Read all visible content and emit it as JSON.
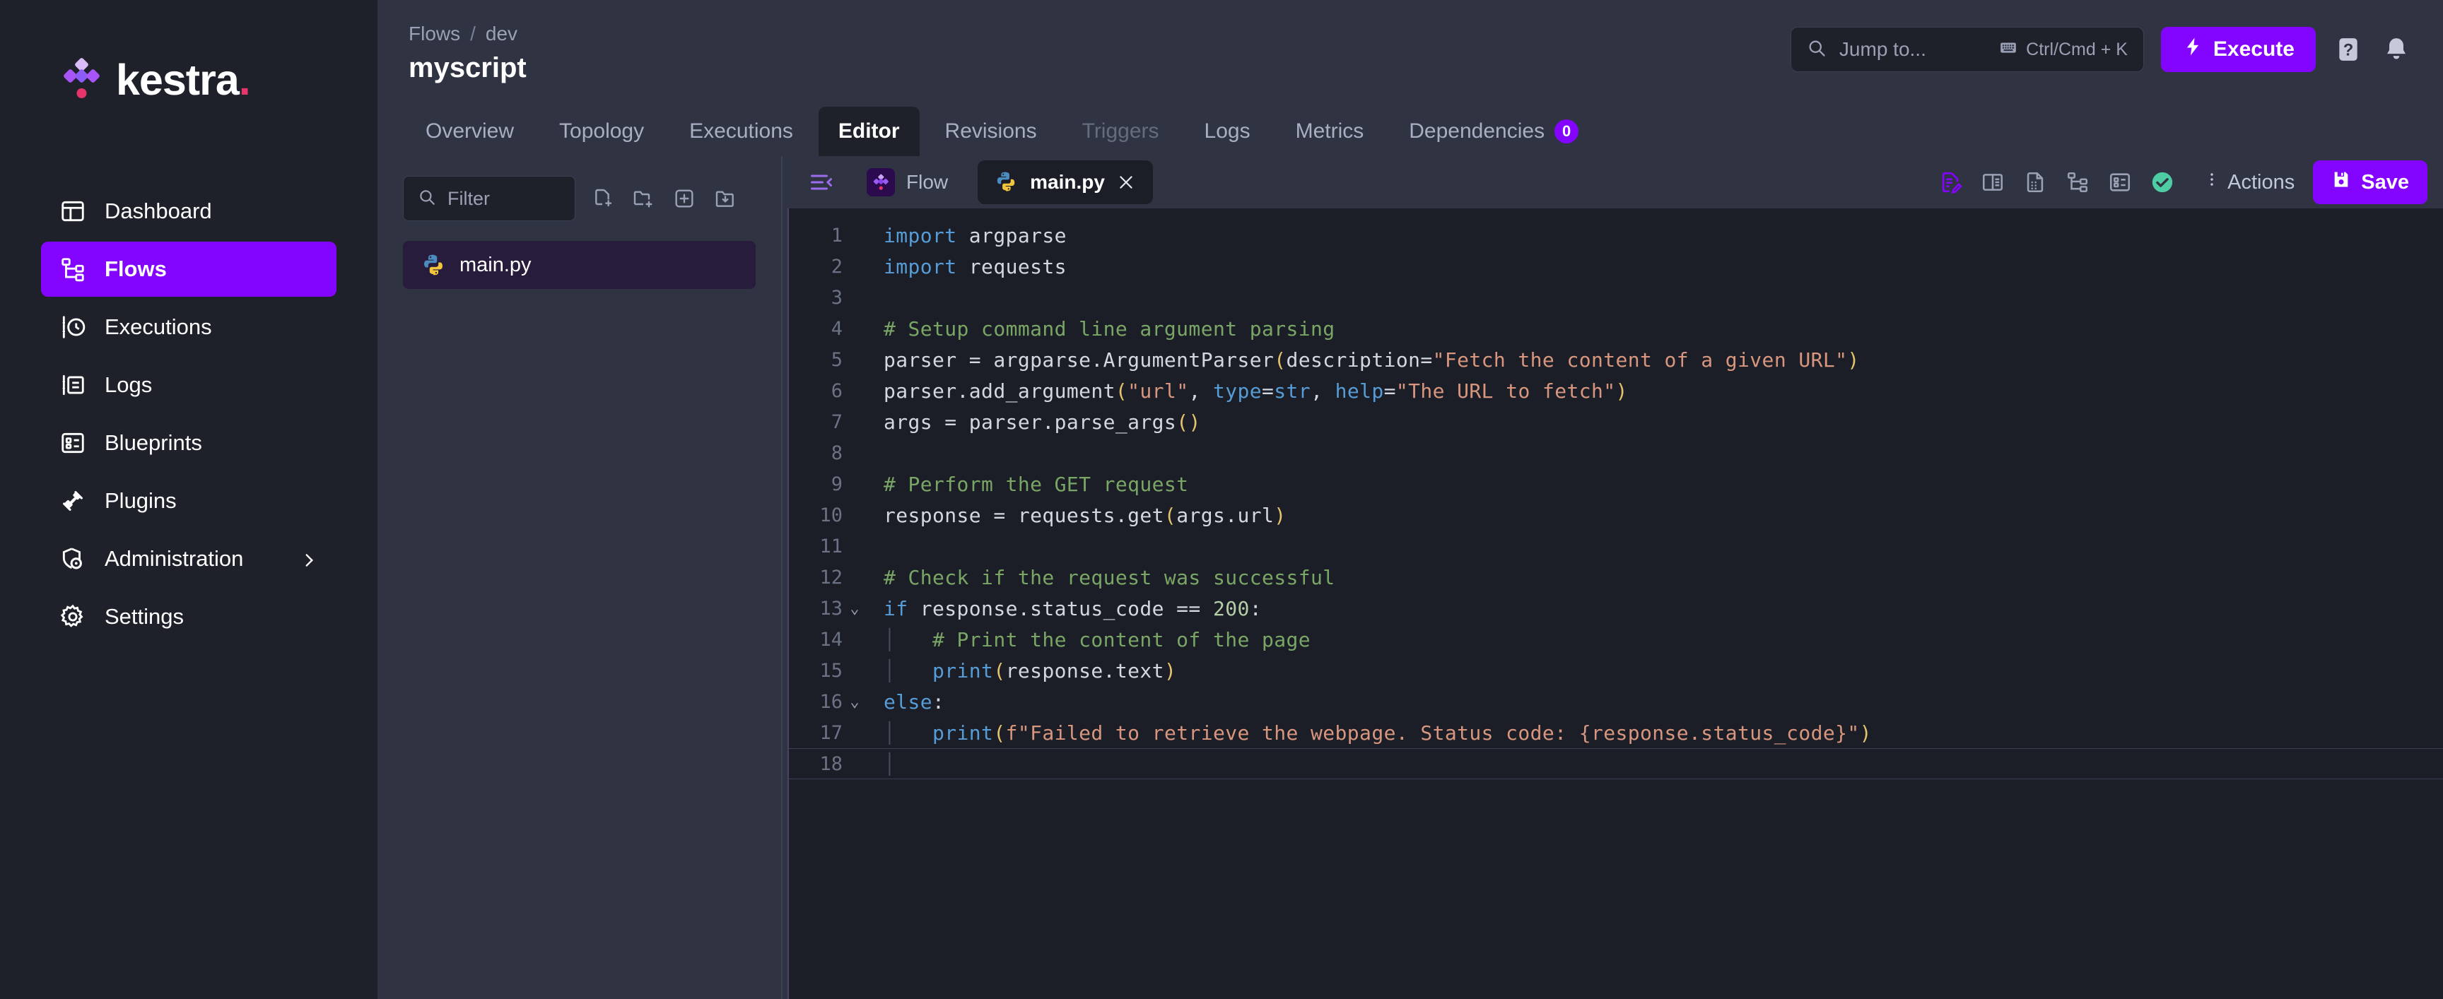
{
  "brand": {
    "name": "kestra",
    "dot": ".",
    "accent": "#8405ff",
    "pink": "#e5356a"
  },
  "sidebar": {
    "items": [
      {
        "label": "Dashboard",
        "icon": "dashboard-icon",
        "active": false,
        "chevron": false
      },
      {
        "label": "Flows",
        "icon": "flows-icon",
        "active": true,
        "chevron": false
      },
      {
        "label": "Executions",
        "icon": "executions-icon",
        "active": false,
        "chevron": false
      },
      {
        "label": "Logs",
        "icon": "logs-icon",
        "active": false,
        "chevron": false
      },
      {
        "label": "Blueprints",
        "icon": "blueprints-icon",
        "active": false,
        "chevron": false
      },
      {
        "label": "Plugins",
        "icon": "plugins-icon",
        "active": false,
        "chevron": false
      },
      {
        "label": "Administration",
        "icon": "administration-icon",
        "active": false,
        "chevron": true
      },
      {
        "label": "Settings",
        "icon": "settings-icon",
        "active": false,
        "chevron": false
      }
    ]
  },
  "header": {
    "breadcrumb": [
      "Flows",
      "dev"
    ],
    "separator": "/",
    "title": "myscript",
    "search": {
      "placeholder": "Jump to...",
      "shortcut": "Ctrl/Cmd + K",
      "icon": "search-icon",
      "kbd_icon": "keyboard-icon"
    },
    "execute_label": "Execute",
    "help_icon": "help-icon",
    "bell_icon": "bell-icon"
  },
  "tabs": [
    {
      "label": "Overview",
      "active": false,
      "disabled": false
    },
    {
      "label": "Topology",
      "active": false,
      "disabled": false
    },
    {
      "label": "Executions",
      "active": false,
      "disabled": false
    },
    {
      "label": "Editor",
      "active": true,
      "disabled": false
    },
    {
      "label": "Revisions",
      "active": false,
      "disabled": false
    },
    {
      "label": "Triggers",
      "active": false,
      "disabled": true
    },
    {
      "label": "Logs",
      "active": false,
      "disabled": false
    },
    {
      "label": "Metrics",
      "active": false,
      "disabled": false
    },
    {
      "label": "Dependencies",
      "active": false,
      "disabled": false,
      "badge": "0"
    }
  ],
  "filepanel": {
    "filter_placeholder": "Filter",
    "search_icon": "search-icon",
    "toolbar": [
      {
        "icon": "new-file-icon",
        "name": "create-file-button"
      },
      {
        "icon": "new-folder-icon",
        "name": "create-folder-button"
      },
      {
        "icon": "add-icon",
        "name": "add-button"
      },
      {
        "icon": "import-folder-icon",
        "name": "import-folder-button"
      }
    ],
    "files": [
      {
        "name": "main.py",
        "icon": "python-icon",
        "selected": true
      }
    ]
  },
  "editor_tabs": {
    "collapse_icon": "collapse-panel-icon",
    "items": [
      {
        "label": "Flow",
        "icon": "kestra-icon",
        "active": false,
        "closable": false
      },
      {
        "label": "main.py",
        "icon": "python-icon",
        "active": true,
        "closable": true,
        "close_icon": "close-icon"
      }
    ]
  },
  "editor_toolbar": {
    "icons": [
      {
        "icon": "edit-file-icon",
        "active": true
      },
      {
        "icon": "split-view-icon",
        "active": false
      },
      {
        "icon": "file-document-icon",
        "active": false
      },
      {
        "icon": "topology-tree-icon",
        "active": false
      },
      {
        "icon": "blueprint-list-icon",
        "active": false
      },
      {
        "icon": "validation-success-icon",
        "active": false,
        "color": "#4ecca3"
      }
    ],
    "actions_label": "Actions",
    "actions_icon": "kebab-menu-icon",
    "save_label": "Save",
    "save_icon": "save-disk-icon"
  },
  "code": {
    "language": "python",
    "filename": "main.py",
    "cursor_line": 18,
    "lines": [
      {
        "n": 1,
        "fold": "",
        "tokens": [
          {
            "t": "kw",
            "v": "import"
          },
          {
            "t": "pl",
            "v": " argparse"
          }
        ]
      },
      {
        "n": 2,
        "fold": "",
        "tokens": [
          {
            "t": "kw",
            "v": "import"
          },
          {
            "t": "pl",
            "v": " requests"
          }
        ]
      },
      {
        "n": 3,
        "fold": "",
        "tokens": []
      },
      {
        "n": 4,
        "fold": "",
        "tokens": [
          {
            "t": "cmt",
            "v": "# Setup command line argument parsing"
          }
        ]
      },
      {
        "n": 5,
        "fold": "",
        "tokens": [
          {
            "t": "pl",
            "v": "parser = argparse.ArgumentParser"
          },
          {
            "t": "par",
            "v": "("
          },
          {
            "t": "pl",
            "v": "description="
          },
          {
            "t": "str",
            "v": "\"Fetch the content of a given URL\""
          },
          {
            "t": "par",
            "v": ")"
          }
        ]
      },
      {
        "n": 6,
        "fold": "",
        "tokens": [
          {
            "t": "pl",
            "v": "parser.add_argument"
          },
          {
            "t": "par",
            "v": "("
          },
          {
            "t": "str",
            "v": "\"url\""
          },
          {
            "t": "pl",
            "v": ", "
          },
          {
            "t": "kw",
            "v": "type"
          },
          {
            "t": "pl",
            "v": "="
          },
          {
            "t": "kw",
            "v": "str"
          },
          {
            "t": "pl",
            "v": ", "
          },
          {
            "t": "kw",
            "v": "help"
          },
          {
            "t": "pl",
            "v": "="
          },
          {
            "t": "str",
            "v": "\"The URL to fetch\""
          },
          {
            "t": "par",
            "v": ")"
          }
        ]
      },
      {
        "n": 7,
        "fold": "",
        "tokens": [
          {
            "t": "pl",
            "v": "args = parser.parse_args"
          },
          {
            "t": "par",
            "v": "()"
          }
        ]
      },
      {
        "n": 8,
        "fold": "",
        "tokens": []
      },
      {
        "n": 9,
        "fold": "",
        "tokens": [
          {
            "t": "cmt",
            "v": "# Perform the GET request"
          }
        ]
      },
      {
        "n": 10,
        "fold": "",
        "tokens": [
          {
            "t": "pl",
            "v": "response = requests.get"
          },
          {
            "t": "par",
            "v": "("
          },
          {
            "t": "pl",
            "v": "args.url"
          },
          {
            "t": "par",
            "v": ")"
          }
        ]
      },
      {
        "n": 11,
        "fold": "",
        "tokens": []
      },
      {
        "n": 12,
        "fold": "",
        "tokens": [
          {
            "t": "cmt",
            "v": "# Check if the request was successful"
          }
        ]
      },
      {
        "n": 13,
        "fold": "v",
        "tokens": [
          {
            "t": "kw",
            "v": "if"
          },
          {
            "t": "pl",
            "v": " response.status_code == "
          },
          {
            "t": "num",
            "v": "200"
          },
          {
            "t": "pl",
            "v": ":"
          }
        ]
      },
      {
        "n": 14,
        "fold": "",
        "tokens": [
          {
            "t": "guide",
            "v": "│ "
          },
          {
            "t": "cmt",
            "v": "  # Print the content of the page"
          }
        ]
      },
      {
        "n": 15,
        "fold": "",
        "tokens": [
          {
            "t": "guide",
            "v": "│ "
          },
          {
            "t": "pl",
            "v": "  "
          },
          {
            "t": "fn",
            "v": "print"
          },
          {
            "t": "par",
            "v": "("
          },
          {
            "t": "pl",
            "v": "response.text"
          },
          {
            "t": "par",
            "v": ")"
          }
        ]
      },
      {
        "n": 16,
        "fold": "v",
        "tokens": [
          {
            "t": "kw",
            "v": "else"
          },
          {
            "t": "pl",
            "v": ":"
          }
        ]
      },
      {
        "n": 17,
        "fold": "",
        "tokens": [
          {
            "t": "guide",
            "v": "│ "
          },
          {
            "t": "pl",
            "v": "  "
          },
          {
            "t": "fn",
            "v": "print"
          },
          {
            "t": "par",
            "v": "("
          },
          {
            "t": "str",
            "v": "f\"Failed to retrieve the webpage. Status code: {response.status_code}\""
          },
          {
            "t": "par",
            "v": ")"
          }
        ]
      },
      {
        "n": 18,
        "fold": "",
        "tokens": [
          {
            "t": "guide",
            "v": "│"
          }
        ]
      }
    ]
  }
}
